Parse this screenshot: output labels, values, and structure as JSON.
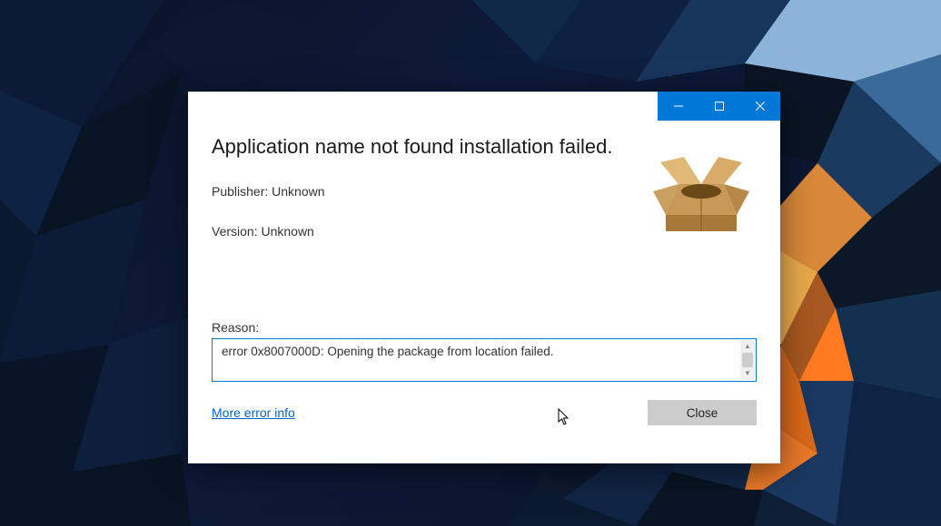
{
  "dialog": {
    "title": "Application name not found installation failed.",
    "publisher_label": "Publisher: Unknown",
    "version_label": "Version: Unknown",
    "reason_label": "Reason:",
    "reason_text": "error 0x8007000D: Opening the package from location  failed.",
    "more_info_link": "More error info",
    "close_button": "Close"
  }
}
